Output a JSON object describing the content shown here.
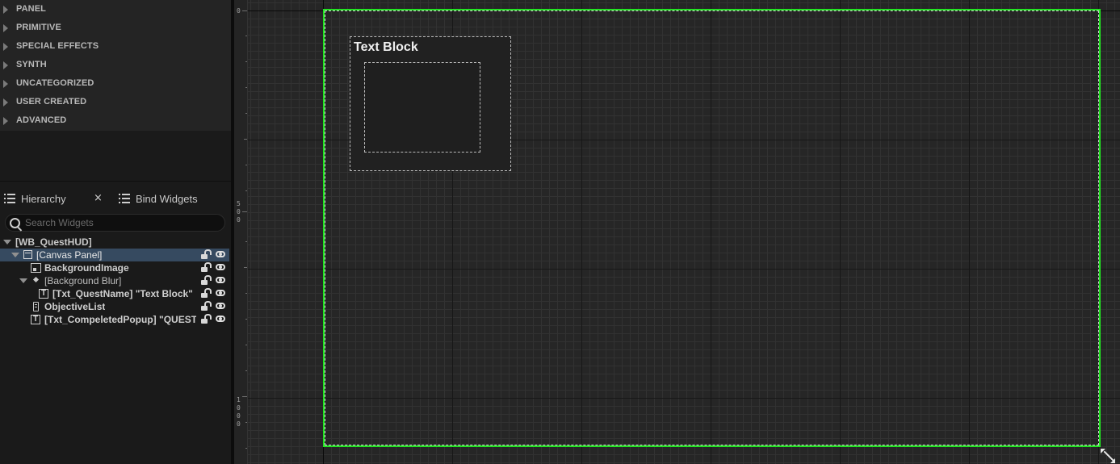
{
  "palette": {
    "categories": [
      "PANEL",
      "PRIMITIVE",
      "SPECIAL EFFECTS",
      "SYNTH",
      "UNCATEGORIZED",
      "USER CREATED",
      "ADVANCED"
    ]
  },
  "tabs": {
    "hierarchy": "Hierarchy",
    "close": "×",
    "bind_widgets": "Bind Widgets"
  },
  "search": {
    "placeholder": "Search Widgets"
  },
  "tree": {
    "root": "[WB_QuestHUD]",
    "items": [
      {
        "label": "[Canvas Panel]",
        "icon": "canvas-panel-icon",
        "selected": true
      },
      {
        "label": "BackgroundImage",
        "icon": "image-icon"
      },
      {
        "label": "[Background Blur]",
        "icon": "blur-icon"
      },
      {
        "label": "[Txt_QuestName] \"Text Block\"",
        "icon": "text-icon"
      },
      {
        "label": "ObjectiveList",
        "icon": "list-view-icon"
      },
      {
        "label": "[Txt_CompeletedPopup] \"QUEST COMPLETE\"",
        "icon": "text-icon"
      }
    ]
  },
  "designer": {
    "ruler": {
      "zero": "0",
      "five_hundred": [
        "5",
        "0",
        "0"
      ],
      "thousand": [
        "1",
        "0",
        "0",
        "0"
      ]
    },
    "text_block_label": "Text Block"
  }
}
